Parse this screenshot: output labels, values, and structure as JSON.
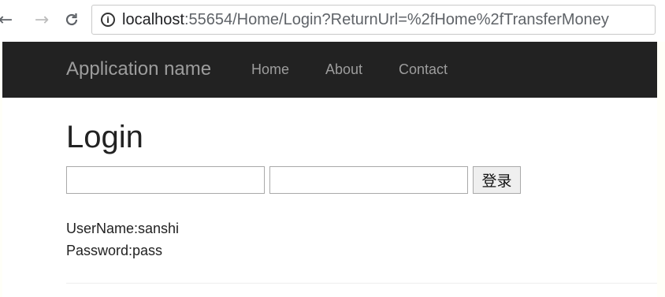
{
  "browser": {
    "back_icon": "←",
    "forward_icon": "→",
    "reload_icon": "C",
    "info_icon": "i",
    "url_host": "localhost",
    "url_rest": ":55654/Home/Login?ReturnUrl=%2fHome%2fTransferMoney"
  },
  "navbar": {
    "brand": "Application name",
    "links": [
      "Home",
      "About",
      "Contact"
    ],
    "background": "#222222",
    "link_color": "#9d9d9d"
  },
  "main": {
    "title": "Login",
    "username_value": "",
    "password_value": "",
    "login_button": "登录",
    "hint_username": "UserName:sanshi",
    "hint_password": "Password:pass"
  }
}
